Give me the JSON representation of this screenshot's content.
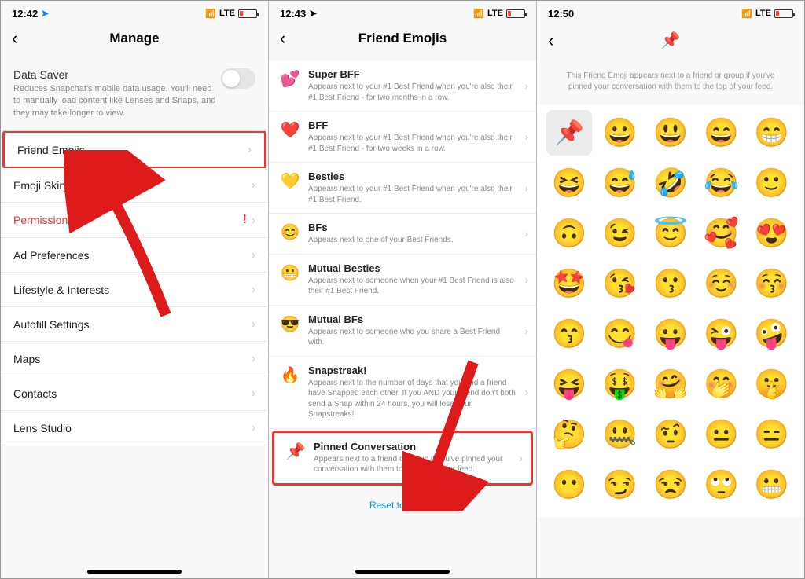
{
  "screen1": {
    "status_time": "12:42",
    "status_net": "LTE",
    "header_title": "Manage",
    "data_saver": {
      "title": "Data Saver",
      "desc": "Reduces Snapchat's mobile data usage. You'll need to manually load content like Lenses and Snaps, and they may take longer to view."
    },
    "rows": [
      {
        "label": "Friend Emojis",
        "highlight": true
      },
      {
        "label": "Emoji Skin Tone"
      },
      {
        "label": "Permissions",
        "danger": true,
        "warn": "!"
      },
      {
        "label": "Ad Preferences"
      },
      {
        "label": "Lifestyle & Interests"
      },
      {
        "label": "Autofill Settings"
      },
      {
        "label": "Maps"
      },
      {
        "label": "Contacts"
      },
      {
        "label": "Lens Studio"
      }
    ]
  },
  "screen2": {
    "status_time": "12:43",
    "status_net": "LTE",
    "header_title": "Friend Emojis",
    "items": [
      {
        "emoji": "💕",
        "title": "Super BFF",
        "desc": "Appears next to your #1 Best Friend when you're also their #1 Best Friend - for two months in a row."
      },
      {
        "emoji": "❤️",
        "title": "BFF",
        "desc": "Appears next to your #1 Best Friend when you're also their #1 Best Friend - for two weeks in a row."
      },
      {
        "emoji": "💛",
        "title": "Besties",
        "desc": "Appears next to your #1 Best Friend when you're also their #1 Best Friend."
      },
      {
        "emoji": "😊",
        "title": "BFs",
        "desc": "Appears next to one of your Best Friends."
      },
      {
        "emoji": "😬",
        "title": "Mutual Besties",
        "desc": "Appears next to someone when your #1 Best Friend is also their #1 Best Friend."
      },
      {
        "emoji": "😎",
        "title": "Mutual BFs",
        "desc": "Appears next to someone who you share a Best Friend with."
      },
      {
        "emoji": "🔥",
        "title": "Snapstreak!",
        "desc": "Appears next to the number of days that you and a friend have Snapped each other. If you AND your friend don't both send a Snap within 24 hours, you will lose your Snapstreaks!"
      },
      {
        "emoji": "📌",
        "title": "Pinned Conversation",
        "desc": "Appears next to a friend or group if you've pinned your conversation with them to the top of your feed.",
        "highlight": true
      }
    ],
    "reset_label": "Reset to default"
  },
  "screen3": {
    "status_time": "12:50",
    "status_net": "LTE",
    "header_emoji": "📌",
    "desc": "This Friend Emoji appears next to a friend or group if you've pinned your conversation with them to the top of your feed.",
    "grid": [
      "📌",
      "😀",
      "😃",
      "😄",
      "😁",
      "😆",
      "😅",
      "🤣",
      "😂",
      "🙂",
      "🙃",
      "😉",
      "😇",
      "🥰",
      "😍",
      "🤩",
      "😘",
      "😗",
      "☺️",
      "😚",
      "😙",
      "😋",
      "😛",
      "😜",
      "🤪",
      "😝",
      "🤑",
      "🤗",
      "🤭",
      "🤫",
      "🤔",
      "🤐",
      "🤨",
      "😐",
      "😑",
      "😶",
      "😏",
      "😒",
      "🙄",
      "😬"
    ]
  }
}
